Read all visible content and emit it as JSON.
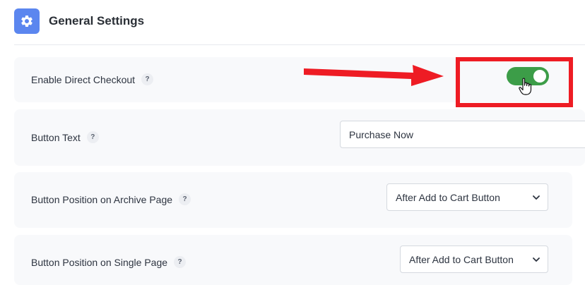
{
  "header": {
    "title": "General Settings",
    "icon": "gear-icon",
    "icon_color": "#5b86ef"
  },
  "settings": {
    "direct_checkout": {
      "label": "Enable Direct Checkout",
      "help": "?",
      "enabled": true,
      "toggle_color": "#3c9d48"
    },
    "button_text": {
      "label": "Button Text",
      "help": "?",
      "value": "Purchase Now"
    },
    "archive_position": {
      "label": "Button Position on Archive Page",
      "help": "?",
      "selected": "After Add to Cart Button"
    },
    "single_position": {
      "label": "Button Position on Single Page",
      "help": "?",
      "selected": "After Add to Cart Button"
    }
  },
  "annotation": {
    "color": "#ee1c24"
  }
}
